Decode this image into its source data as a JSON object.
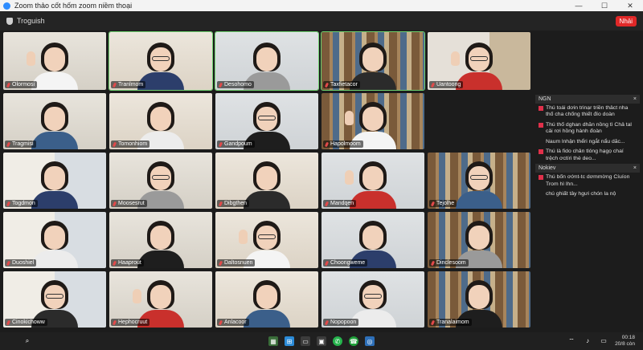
{
  "window": {
    "title": "Zoom thảo cốt hốm zoom niềm thoại"
  },
  "toolbar": {
    "title": "Troguish",
    "end_label": "Nhải"
  },
  "participants": [
    "Olormosi",
    "Tranlmom",
    "Desohomo",
    "Taxfietacor",
    "Uantoong",
    "Tragmisi",
    "Tomonhiom",
    "Gandpoum",
    "Hapolmoom",
    "Togdmon",
    "Moosesrut",
    "Dibgthen",
    "Mandqen",
    "Tejolhe",
    "Duoshiel",
    "Haaprout",
    "Daltosnuen",
    "Choongweme",
    "Dinclesoom",
    "Cinokichoww",
    "Hephocruut",
    "Anlacoor",
    "Nopopoon",
    "Tranalaimom"
  ],
  "chat": {
    "header1": "NGN",
    "messages1": [
      {
        "flag": true,
        "text": "Thú toái dơin trinạr triền thâct nha thố cha chống thiết đío doàn"
      },
      {
        "flag": true,
        "text": "Thú thố dghan dhăn nồng tì Chả tal cải rơi hồng hành đoàn"
      },
      {
        "flag": false,
        "text": "Naum lnhận thểri ngắt nẩu dăc..."
      },
      {
        "flag": true,
        "text": "Thú là fido chân tlóng hạgọ chaí trệch ơctíri thè deo..."
      }
    ],
    "header2": "Nokiev",
    "messages2": [
      {
        "flag": true,
        "text": "Thú bốn ơớnt-tc dơmmờng Cíuíon Trom hì lhn..."
      },
      {
        "flag": false,
        "text": "chú ghiất tây hgưi chón la nộ"
      }
    ]
  },
  "taskbar": {
    "time": "00:18",
    "date": "20/8 còn"
  },
  "colors": {
    "active_border": "#6fd26f",
    "end_button": "#e02828",
    "mic_muted": "#e24a4a"
  },
  "icons": [
    "search-icon",
    "windows-start-icon",
    "widgets-icon",
    "screen-share-icon",
    "camera-icon",
    "whatsapp-icon",
    "phone-icon",
    "security-icon",
    "wifi-icon",
    "volume-icon",
    "battery-icon"
  ]
}
